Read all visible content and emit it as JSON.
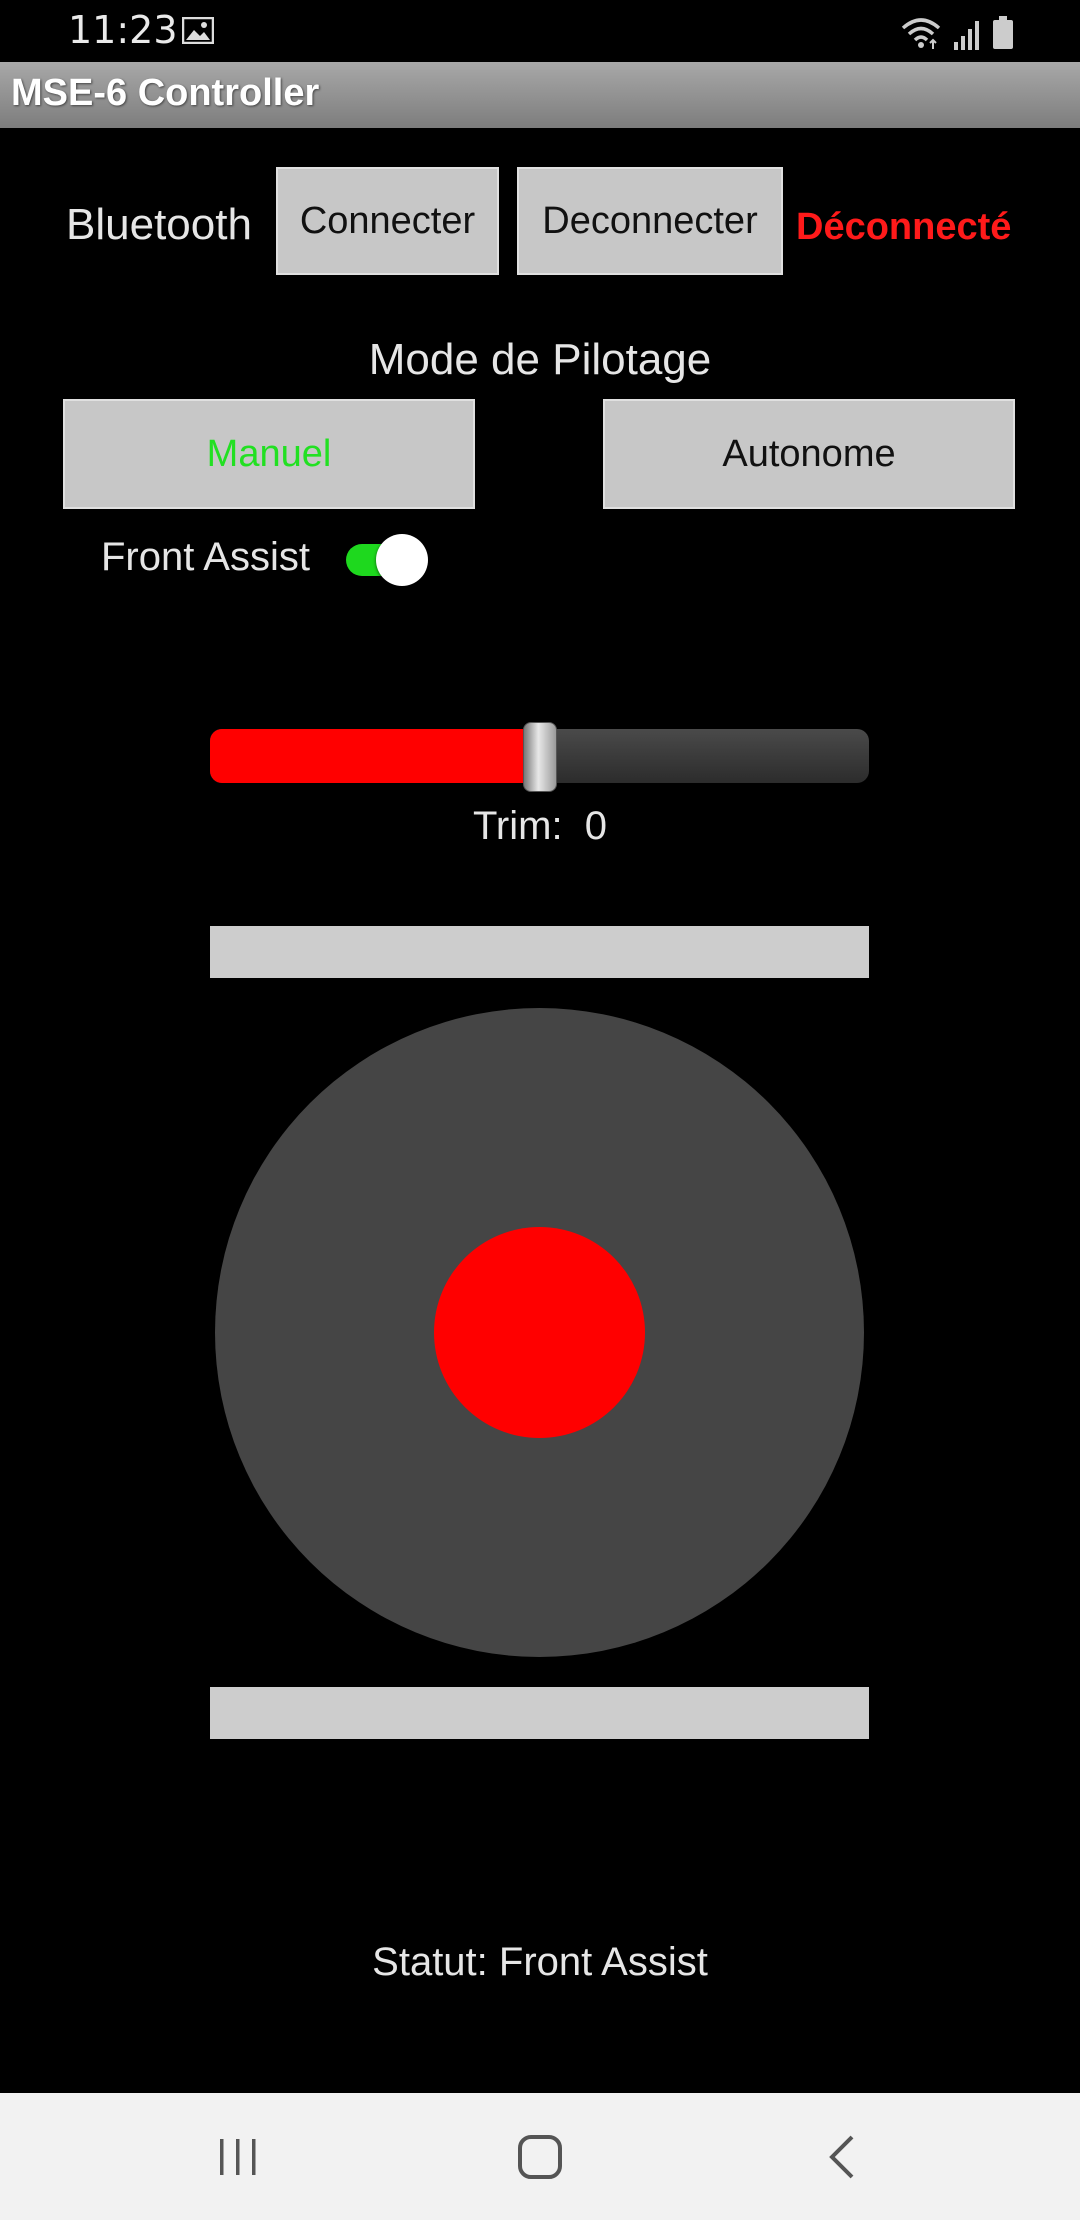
{
  "status_bar": {
    "time": "11:23",
    "icons": [
      "gallery-icon",
      "wifi-icon",
      "signal-icon",
      "battery-icon"
    ]
  },
  "app": {
    "title": "MSE-6 Controller"
  },
  "bluetooth": {
    "label": "Bluetooth",
    "connect_label": "Connecter",
    "disconnect_label": "Deconnecter",
    "status": "Déconnecté",
    "status_color": "#ff1a1a"
  },
  "pilot_mode": {
    "title": "Mode de Pilotage",
    "manual_label": "Manuel",
    "auto_label": "Autonome",
    "active": "manual",
    "active_color": "#22e022"
  },
  "front_assist": {
    "label": "Front Assist",
    "enabled": true,
    "toggle_color": "#1ed81e"
  },
  "trim": {
    "label": "Trim:  0",
    "value": 0,
    "min": -50,
    "max": 50,
    "fill_color": "#ff0000"
  },
  "joystick": {
    "base_color": "#454545",
    "knob_color": "#ff0000"
  },
  "status": {
    "text": "Statut: Front Assist"
  },
  "nav_bar": {
    "icons": [
      "recent-apps-icon",
      "home-icon",
      "back-icon"
    ]
  }
}
